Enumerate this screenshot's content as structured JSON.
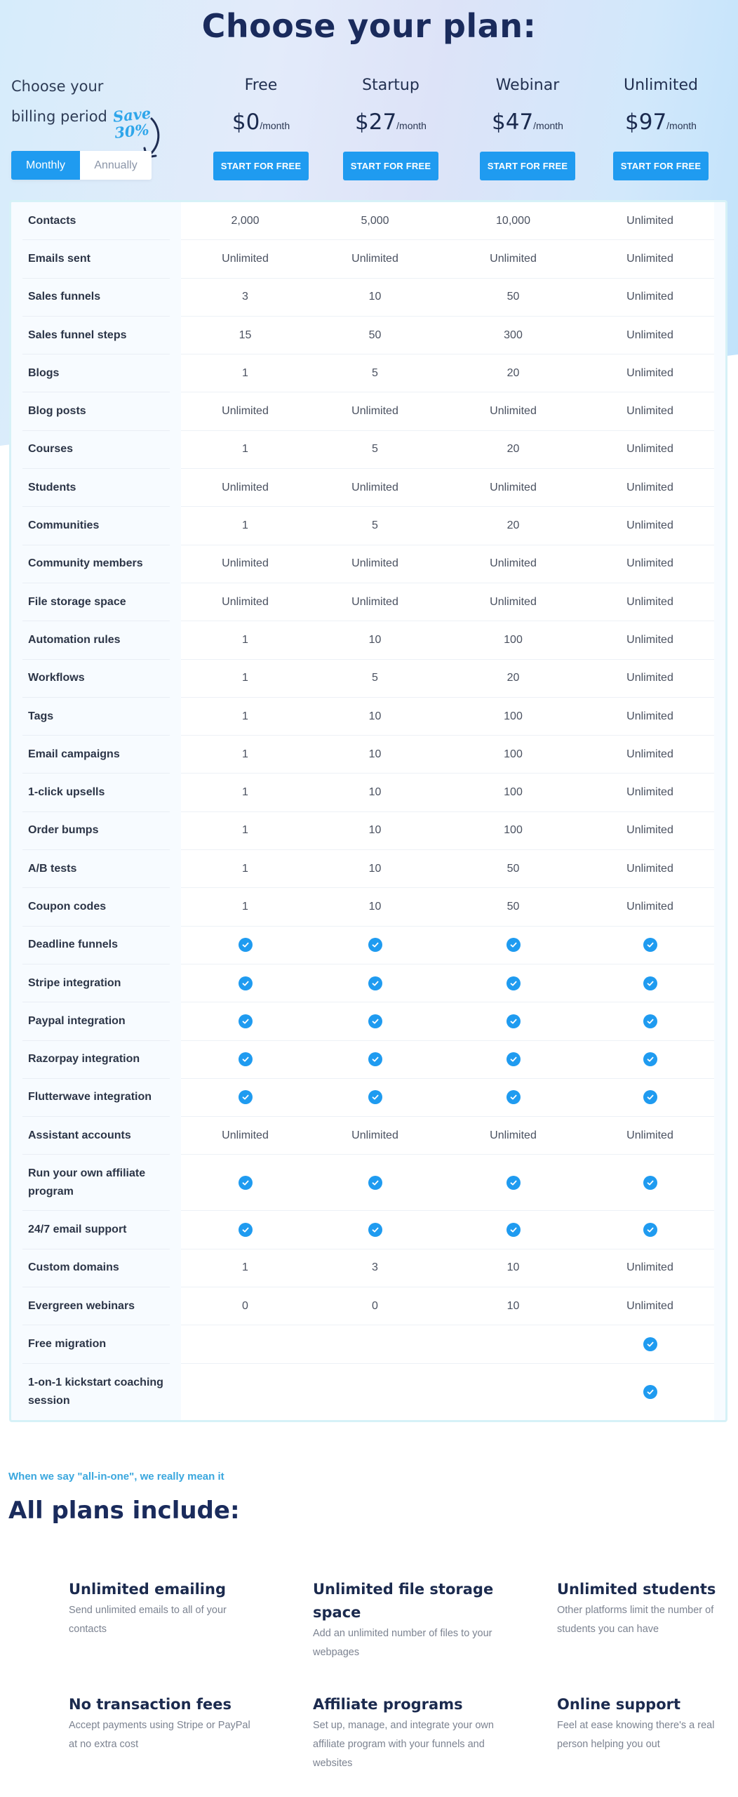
{
  "header": {
    "title": "Choose your plan:",
    "billing_label": "Choose your billing period",
    "save_note_line1": "Save",
    "save_note_line2": "30%",
    "toggle": {
      "monthly": "Monthly",
      "annually": "Annually",
      "selected": "Monthly"
    }
  },
  "colors": {
    "accent": "#1f9bf0",
    "heading": "#1a2b5c",
    "tagline": "#3aa7de",
    "table_border": "#d6f1f7"
  },
  "plans": [
    {
      "name": "Free",
      "price": "$0",
      "period": "/month",
      "cta": "START FOR FREE"
    },
    {
      "name": "Startup",
      "price": "$27",
      "period": "/month",
      "cta": "START FOR FREE"
    },
    {
      "name": "Webinar",
      "price": "$47",
      "period": "/month",
      "cta": "START FOR FREE"
    },
    {
      "name": "Unlimited",
      "price": "$97",
      "period": "/month",
      "cta": "START FOR FREE"
    }
  ],
  "check_icon": "check-circle-icon",
  "features_table": [
    {
      "feature": "Contacts",
      "values": [
        "2,000",
        "5,000",
        "10,000",
        "Unlimited"
      ]
    },
    {
      "feature": "Emails sent",
      "values": [
        "Unlimited",
        "Unlimited",
        "Unlimited",
        "Unlimited"
      ]
    },
    {
      "feature": "Sales funnels",
      "values": [
        "3",
        "10",
        "50",
        "Unlimited"
      ]
    },
    {
      "feature": "Sales funnel steps",
      "values": [
        "15",
        "50",
        "300",
        "Unlimited"
      ]
    },
    {
      "feature": "Blogs",
      "values": [
        "1",
        "5",
        "20",
        "Unlimited"
      ]
    },
    {
      "feature": "Blog posts",
      "values": [
        "Unlimited",
        "Unlimited",
        "Unlimited",
        "Unlimited"
      ]
    },
    {
      "feature": "Courses",
      "values": [
        "1",
        "5",
        "20",
        "Unlimited"
      ]
    },
    {
      "feature": "Students",
      "values": [
        "Unlimited",
        "Unlimited",
        "Unlimited",
        "Unlimited"
      ]
    },
    {
      "feature": "Communities",
      "values": [
        "1",
        "5",
        "20",
        "Unlimited"
      ]
    },
    {
      "feature": "Community members",
      "values": [
        "Unlimited",
        "Unlimited",
        "Unlimited",
        "Unlimited"
      ]
    },
    {
      "feature": "File storage space",
      "values": [
        "Unlimited",
        "Unlimited",
        "Unlimited",
        "Unlimited"
      ]
    },
    {
      "feature": "Automation rules",
      "values": [
        "1",
        "10",
        "100",
        "Unlimited"
      ]
    },
    {
      "feature": "Workflows",
      "values": [
        "1",
        "5",
        "20",
        "Unlimited"
      ]
    },
    {
      "feature": "Tags",
      "values": [
        "1",
        "10",
        "100",
        "Unlimited"
      ]
    },
    {
      "feature": "Email campaigns",
      "values": [
        "1",
        "10",
        "100",
        "Unlimited"
      ]
    },
    {
      "feature": "1-click upsells",
      "values": [
        "1",
        "10",
        "100",
        "Unlimited"
      ]
    },
    {
      "feature": "Order bumps",
      "values": [
        "1",
        "10",
        "100",
        "Unlimited"
      ]
    },
    {
      "feature": "A/B tests",
      "values": [
        "1",
        "10",
        "50",
        "Unlimited"
      ]
    },
    {
      "feature": "Coupon codes",
      "values": [
        "1",
        "10",
        "50",
        "Unlimited"
      ]
    },
    {
      "feature": "Deadline funnels",
      "values": [
        true,
        true,
        true,
        true
      ]
    },
    {
      "feature": "Stripe integration",
      "values": [
        true,
        true,
        true,
        true
      ]
    },
    {
      "feature": "Paypal integration",
      "values": [
        true,
        true,
        true,
        true
      ]
    },
    {
      "feature": "Razorpay integration",
      "values": [
        true,
        true,
        true,
        true
      ]
    },
    {
      "feature": "Flutterwave integration",
      "values": [
        true,
        true,
        true,
        true
      ]
    },
    {
      "feature": "Assistant accounts",
      "values": [
        "Unlimited",
        "Unlimited",
        "Unlimited",
        "Unlimited"
      ]
    },
    {
      "feature": "Run your own affiliate program",
      "values": [
        true,
        true,
        true,
        true
      ],
      "tall": true
    },
    {
      "feature": "24/7 email support",
      "values": [
        true,
        true,
        true,
        true
      ]
    },
    {
      "feature": "Custom domains",
      "values": [
        "1",
        "3",
        "10",
        "Unlimited"
      ]
    },
    {
      "feature": "Evergreen webinars",
      "values": [
        "0",
        "0",
        "10",
        "Unlimited"
      ]
    },
    {
      "feature": "Free migration",
      "values": [
        "",
        "",
        "",
        true
      ]
    },
    {
      "feature": "1-on-1 kickstart coaching session",
      "values": [
        "",
        "",
        "",
        true
      ],
      "tall": true
    }
  ],
  "all_plans": {
    "tagline": "When we say \"all-in-one\", we really mean it",
    "title": "All plans include:",
    "items": [
      {
        "title": "Unlimited emailing",
        "desc": "Send unlimited emails to all of your contacts"
      },
      {
        "title": "Unlimited file storage space",
        "desc": "Add an unlimited number of files to your webpages"
      },
      {
        "title": "Unlimited students",
        "desc": "Other platforms limit the number of students you can have"
      },
      {
        "title": "No transaction fees",
        "desc": "Accept payments using Stripe or PayPal at no extra cost"
      },
      {
        "title": "Affiliate programs",
        "desc": "Set up, manage, and integrate your own affiliate program with your funnels and websites"
      },
      {
        "title": "Online support",
        "desc": "Feel at ease knowing there's a real person helping you out"
      }
    ]
  }
}
